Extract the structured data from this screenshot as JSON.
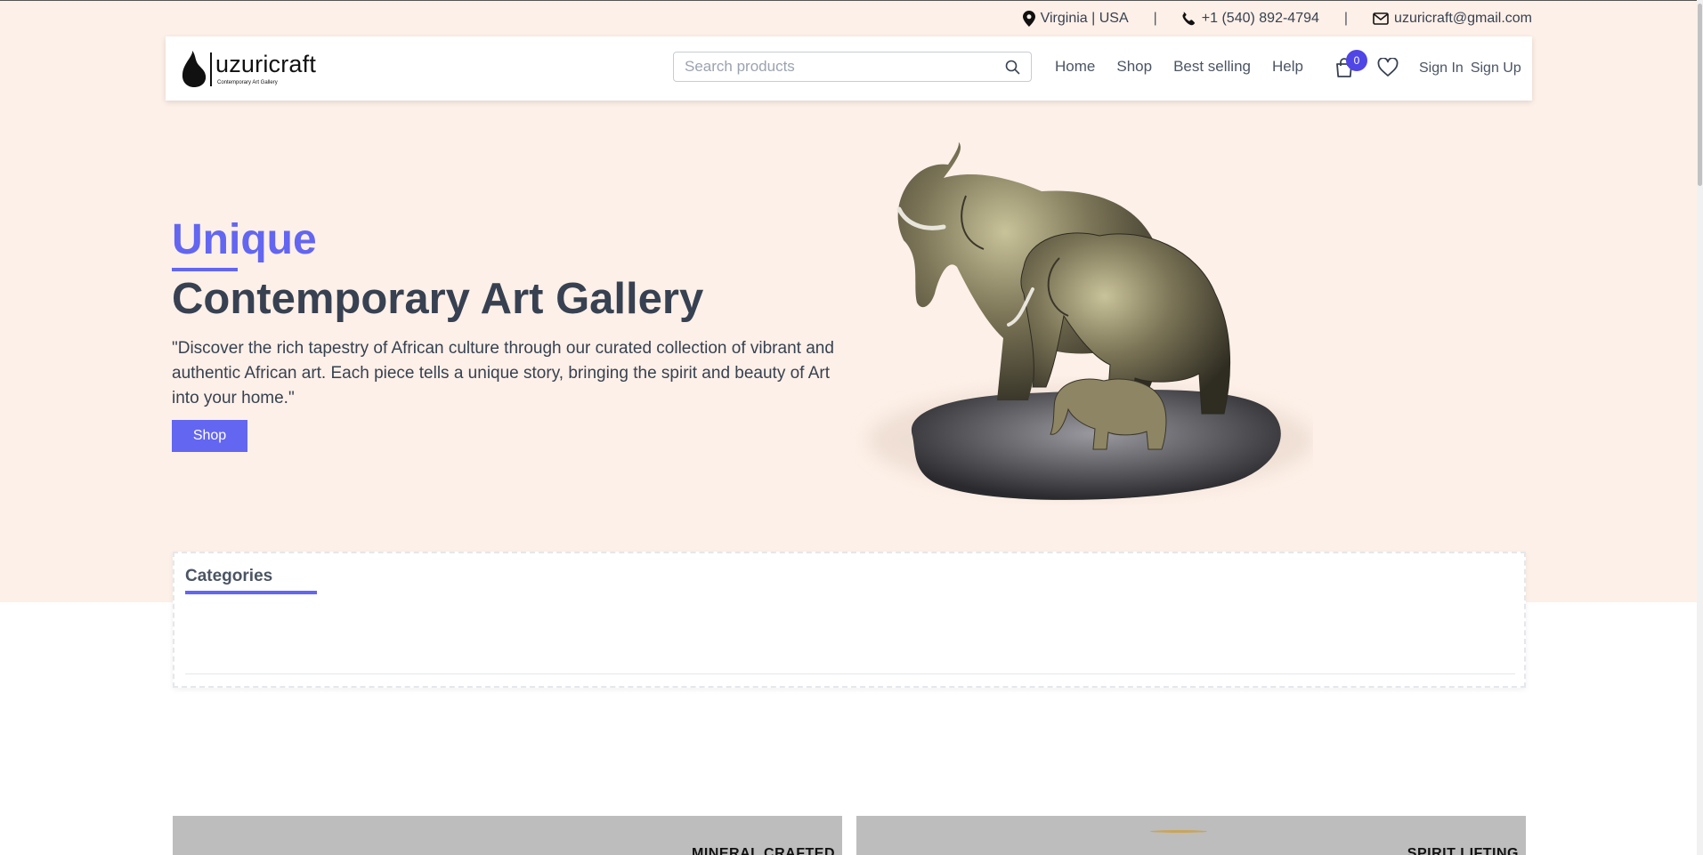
{
  "topbar": {
    "location": "Virginia | USA",
    "phone": "+1 (540) 892-4794",
    "email": "uzuricraft@gmail.com",
    "separator": "|"
  },
  "header": {
    "logo_name": "uzuricraft",
    "logo_tagline": "Contemporary Art Gallery",
    "search_placeholder": "Search products",
    "nav": [
      "Home",
      "Shop",
      "Best selling",
      "Help"
    ],
    "cart_count": "0",
    "sign_in": "Sign In",
    "sign_up": "Sign Up"
  },
  "hero": {
    "subtitle": "Unique",
    "title": "Contemporary Art Gallery",
    "description": "\"Discover the rich tapestry of African culture through our curated collection of vibrant and authentic African art. Each piece tells a unique story, bringing the spirit and beauty of Art into your home.\"",
    "shop_button": "Shop"
  },
  "categories": {
    "title": "Categories"
  },
  "cards": [
    {
      "label": "MINERAL CRAFTED"
    },
    {
      "label": "SPIRIT LIFTING"
    }
  ],
  "colors": {
    "accent": "#6366f1",
    "hero_bg": "#fdf0e8",
    "badge": "#4f46e5"
  }
}
